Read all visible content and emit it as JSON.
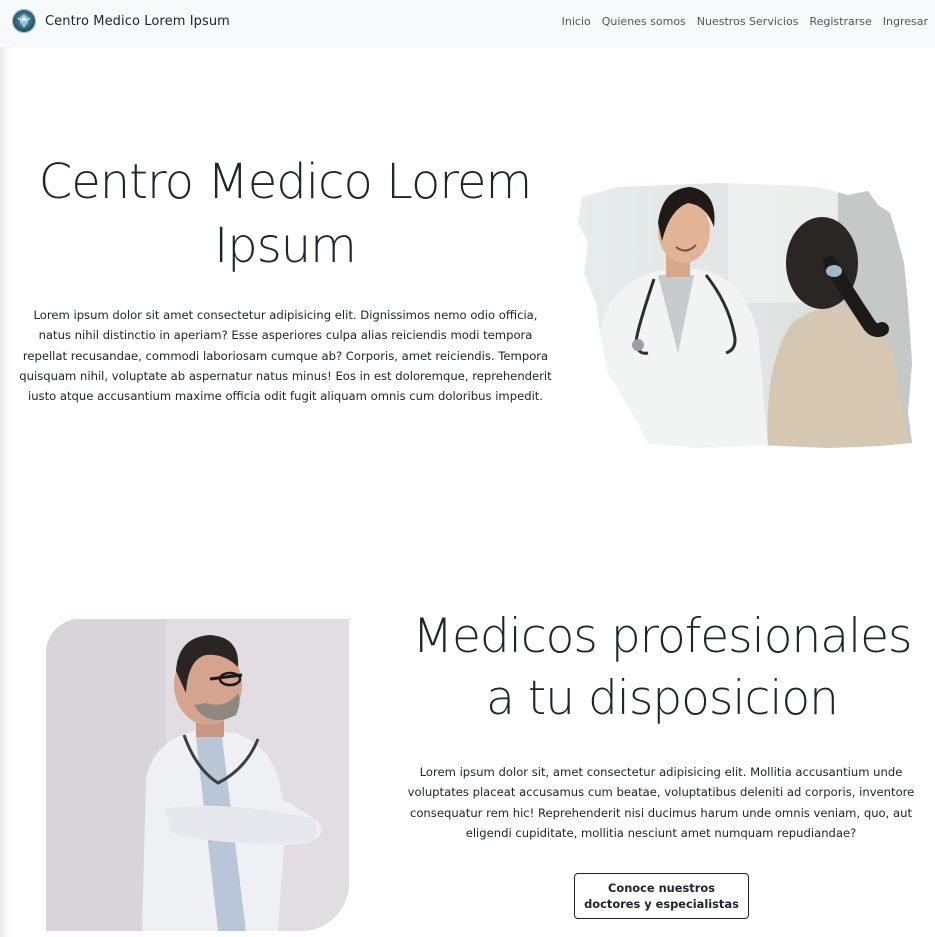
{
  "navbar": {
    "brand": "Centro Medico Lorem Ipsum",
    "logo_icon": "medical-logo-icon",
    "links": [
      "Inicio",
      "Quienes somos",
      "Nuestros Servicios",
      "Registrarse",
      "Ingresar"
    ]
  },
  "hero": {
    "title": "Centro Medico Lorem Ipsum",
    "text": "Lorem ipsum dolor sit amet consectetur adipisicing elit. Dignissimos nemo odio officia, natus nihil distinctio in aperiam? Esse asperiores culpa alias reiciendis modi tempora repellat recusandae, commodi laboriosam cumque ab? Corporis, amet reiciendis. Tempora quisquam nihil, voluptate ab aspernatur natus minus! Eos in est doloremque, reprehenderit iusto atque accusantium maxime officia odit fugit aliquam omnis cum doloribus impedit."
  },
  "section2": {
    "title": "Medicos profesionales a tu disposicion",
    "text": "Lorem ipsum dolor sit, amet consectetur adipisicing elit. Mollitia accusantium unde voluptates placeat accusamus cum beatae, voluptatibus deleniti ad corporis, inventore consequatur rem hic! Reprehenderit nisi ducimus harum unde omnis veniam, quo, aut eligendi cupiditate, mollitia nesciunt amet numquam repudiandae?",
    "button": "Conoce nuestros doctores y especialistas"
  },
  "colors": {
    "navbar_bg": "#f8f9fa",
    "text": "#212529",
    "button_border": "#212529"
  }
}
